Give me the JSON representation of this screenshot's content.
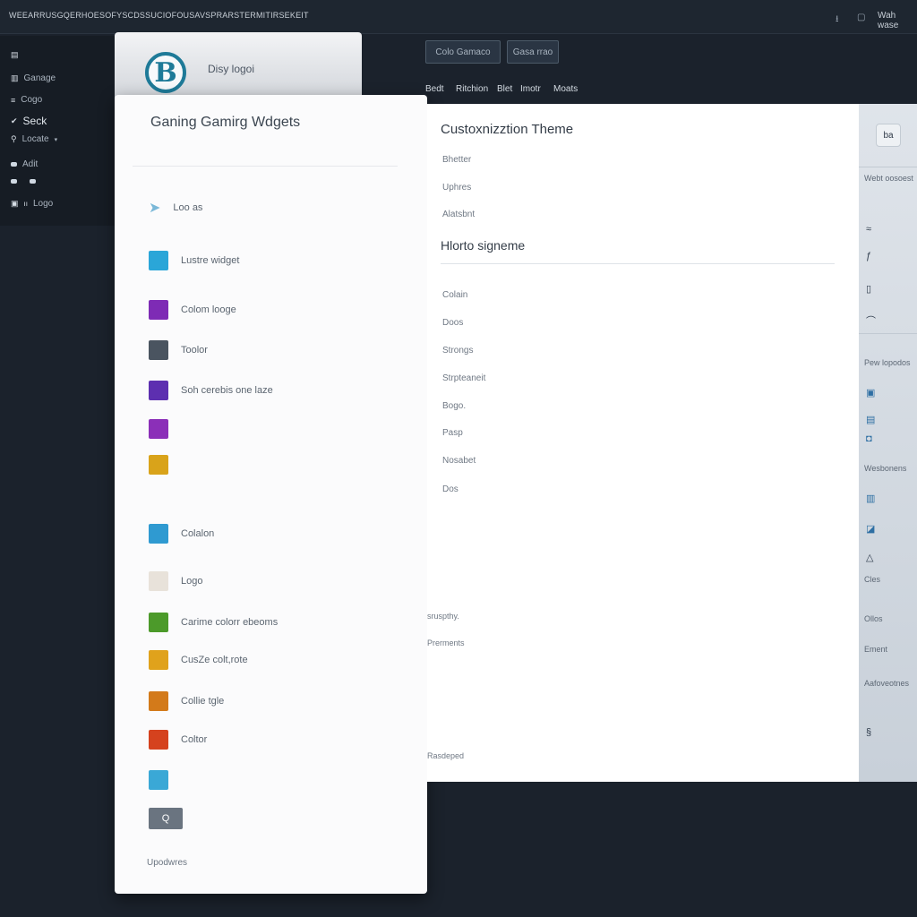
{
  "window": {
    "title": "WEEARRUSGQERHOESOFYSCDSSUCIOFOUSAVSPRARSTERMITIRSEKEIT",
    "user": "Wah wase"
  },
  "sidebar": {
    "items": [
      {
        "label": "",
        "icon": "grid-icon"
      },
      {
        "label": "Ganage",
        "icon": "panel-icon"
      },
      {
        "label": "Cogo",
        "icon": "menu-icon"
      },
      {
        "label": "Seck",
        "icon": "check-icon"
      },
      {
        "label": "Locate",
        "icon": "search-icon"
      },
      {
        "label": "Adit",
        "icon": "edit-icon"
      },
      {
        "label": "",
        "icon": "pen-icon"
      },
      {
        "label": "Logo",
        "icon": "image-icon"
      }
    ]
  },
  "logo_card": {
    "text": "Disy logoi"
  },
  "top_buttons": [
    "Colo Gamaco",
    "Gasa rrao"
  ],
  "menu": [
    "Bedt",
    "Ritchion",
    "Blet",
    "Imotr",
    "Moats"
  ],
  "widget_panel": {
    "title": "Ganing Gamirg Wdgets",
    "rows": [
      {
        "label": "Loo as",
        "color": "#7ab8d8"
      },
      {
        "label": "Lustre widget",
        "color": "#2aa6d8"
      },
      {
        "label": "Colom looge",
        "color": "#7e2bb5"
      },
      {
        "label": "Toolor",
        "color": "#4a5460"
      },
      {
        "label": "Soh cerebis one laze",
        "color": "#5d2fb0"
      },
      {
        "label": "",
        "color": "#8b2fb8"
      },
      {
        "label": "",
        "color": "#d9a31a"
      },
      {
        "label": "Colalon",
        "color": "#2f9ad1"
      },
      {
        "label": "Logo",
        "color": "#e8e2da"
      },
      {
        "label": "Carime colorr ebeoms",
        "color": "#4c9a2a"
      },
      {
        "label": "CusZe colt,rote",
        "color": "#e0a21c"
      },
      {
        "label": "Collie tgle",
        "color": "#d37a1a"
      },
      {
        "label": "Coltor",
        "color": "#d5421e"
      },
      {
        "label": "",
        "color": "#3aa8d6"
      }
    ],
    "search_button": "Q",
    "footer": "Upodwres"
  },
  "content": {
    "header": "Custoxnizztion Theme",
    "subitems": [
      "Bhetter",
      "Uphres",
      "Alatsbnt"
    ],
    "section_title": "Hlorto signeme",
    "list": [
      "Colain",
      "Doos",
      "Strongs",
      "Strpteaneit",
      "Bogo.",
      "Pasp",
      "Nosabet",
      "Dos"
    ],
    "notes": [
      "sruspthy.",
      "Prerments",
      "Rasdeped"
    ]
  },
  "rightbar": {
    "labels": [
      "Webt oosoest",
      "Pew lopodos",
      "Wesbonens",
      "Cles",
      "Ollos",
      "Ement",
      "Aafoveotnes"
    ],
    "box": "ba"
  }
}
